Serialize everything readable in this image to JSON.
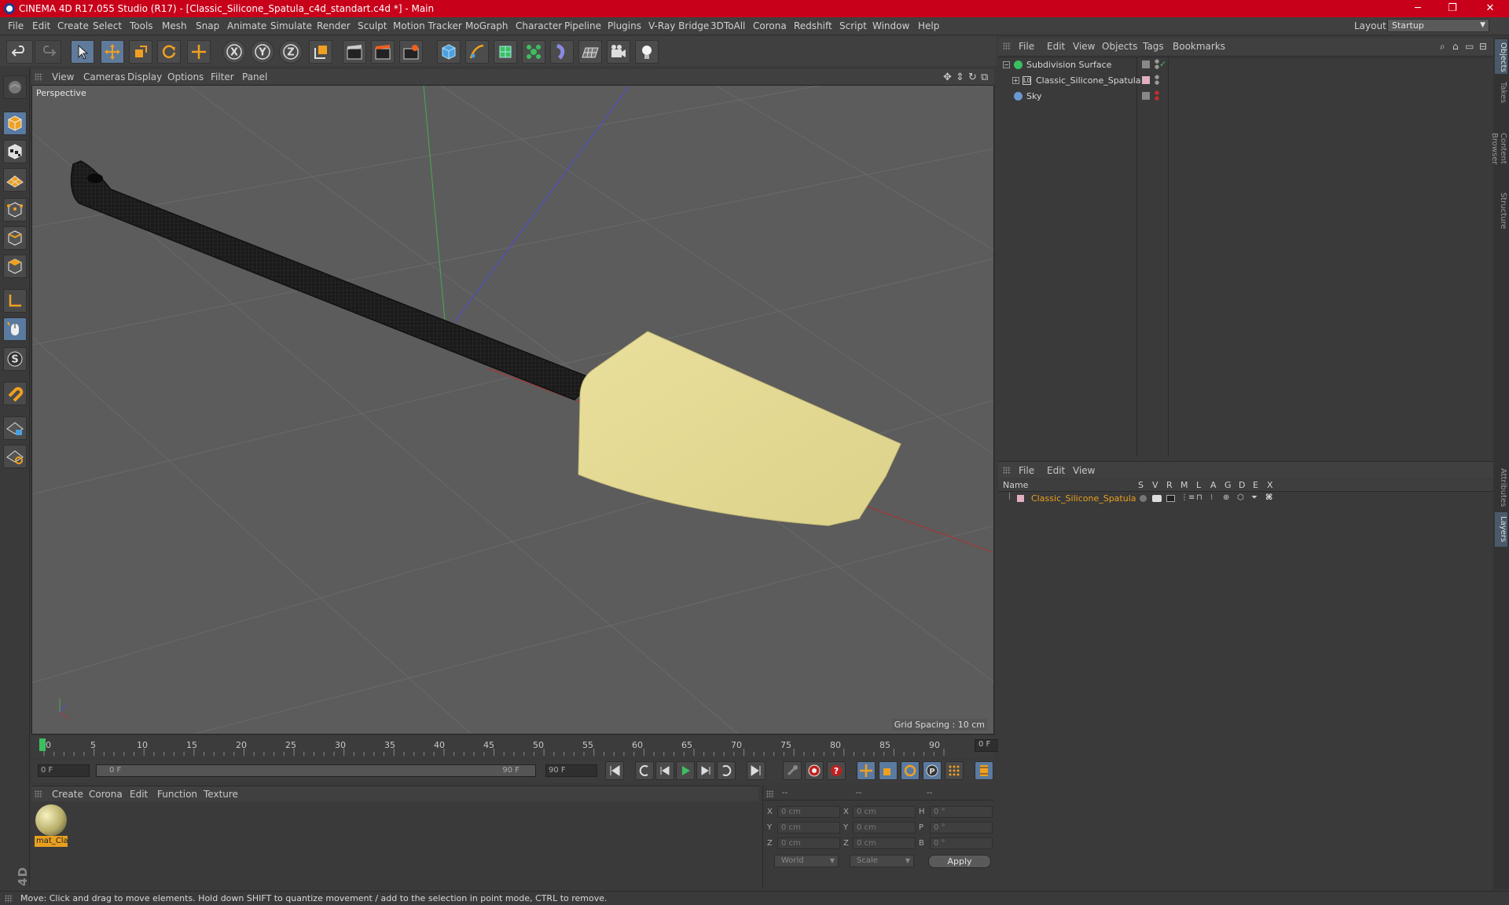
{
  "window": {
    "title": "CINEMA 4D R17.055 Studio (R17) - [Classic_Silicone_Spatula_c4d_standart.c4d *] - Main",
    "minimize": "─",
    "restore": "❐",
    "close": "✕"
  },
  "menubar": {
    "items": [
      "File",
      "Edit",
      "Create",
      "Select",
      "Tools",
      "Mesh",
      "Snap",
      "Animate",
      "Simulate",
      "Render",
      "Sculpt",
      "Motion Tracker",
      "MoGraph",
      "Character",
      "Pipeline",
      "Plugins",
      "V-Ray Bridge",
      "3DToAll",
      "Corona",
      "Redshift",
      "Script",
      "Window",
      "Help"
    ],
    "layout_label": "Layout:",
    "layout_value": "Startup"
  },
  "toolbar": {
    "axis_x": "X",
    "axis_y": "Y",
    "axis_z": "Z"
  },
  "viewport": {
    "menu": [
      "View",
      "Cameras",
      "Display",
      "Options",
      "Filter",
      "Panel"
    ],
    "camera_label": "Perspective",
    "grid_spacing": "Grid Spacing : 10 cm"
  },
  "timeline": {
    "ticks": [
      "0",
      "5",
      "10",
      "15",
      "20",
      "25",
      "30",
      "35",
      "40",
      "45",
      "50",
      "55",
      "60",
      "65",
      "70",
      "75",
      "80",
      "85",
      "90"
    ],
    "current_frame": "0 F"
  },
  "playback": {
    "start_frame": "0 F",
    "range_start": "0 F",
    "range_end": "90 F",
    "end_frame": "90 F"
  },
  "material_manager": {
    "menu": [
      "Create",
      "Corona",
      "Edit",
      "Function",
      "Texture"
    ],
    "material_name": "mat_Cla"
  },
  "coordinates": {
    "header": [
      "--",
      "--",
      "--"
    ],
    "rows": [
      {
        "l1": "X",
        "v1": "0 cm",
        "l2": "X",
        "v2": "0 cm",
        "l3": "H",
        "v3": "0 °"
      },
      {
        "l1": "Y",
        "v1": "0 cm",
        "l2": "Y",
        "v2": "0 cm",
        "l3": "P",
        "v3": "0 °"
      },
      {
        "l1": "Z",
        "v1": "0 cm",
        "l2": "Z",
        "v2": "0 cm",
        "l3": "B",
        "v3": "0 °"
      }
    ],
    "space": "World",
    "mode": "Scale",
    "apply": "Apply"
  },
  "status": {
    "text": "Move: Click and drag to move elements. Hold down SHIFT to quantize movement / add to the selection in point mode, CTRL to remove."
  },
  "objects_manager": {
    "menu": [
      "File",
      "Edit",
      "View",
      "Objects",
      "Tags",
      "Bookmarks"
    ],
    "objects": [
      {
        "name": "Subdivision Surface"
      },
      {
        "name": "Classic_Silicone_Spatula"
      },
      {
        "name": "Sky"
      }
    ]
  },
  "layers_manager": {
    "menu": [
      "File",
      "Edit",
      "View"
    ],
    "columns": [
      "Name",
      "S",
      "V",
      "R",
      "M",
      "L",
      "A",
      "G",
      "D",
      "E",
      "X"
    ],
    "layer_name": "Classic_Silicone_Spatula",
    "layer_color": "#e8a020"
  },
  "right_tabs": [
    "Objects",
    "Takes",
    "Content Browser",
    "Structure",
    "Attributes",
    "Layers"
  ],
  "colors": {
    "titlebar": "#c8001a",
    "spatula_head": "#e6dc96",
    "handle": "#1e1e1e",
    "accent_orange": "#e8a020"
  }
}
